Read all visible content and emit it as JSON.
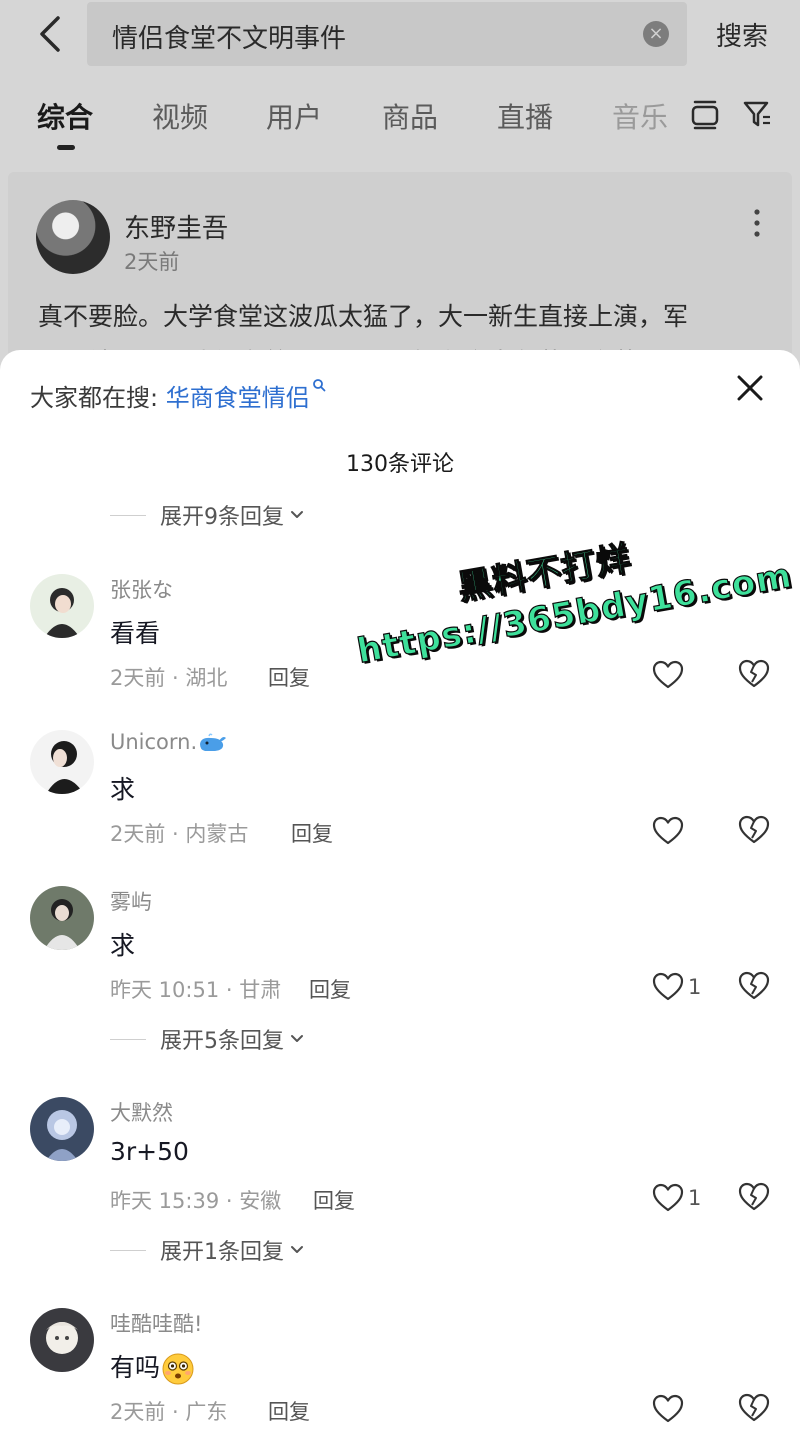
{
  "search": {
    "query": "情侣食堂不文明事件",
    "clear_icon": "×",
    "submit_label": "搜索"
  },
  "tabs": [
    "综合",
    "视频",
    "用户",
    "商品",
    "直播",
    "音乐"
  ],
  "post": {
    "author": "东野圭吾",
    "time": "2天前",
    "text_line1": "真不要脸。大学食堂这波瓜太猛了，大一新生直接上演，军",
    "text_line2": "训刚结束，小情侣穿着迷彩军训服接在食堂角落，竟若无人"
  },
  "sheet": {
    "hot_label": "大家都在搜:",
    "hot_term": "华商食堂情侣",
    "comment_count": "130条评论",
    "expand_top": "展开9条回复"
  },
  "comments": [
    {
      "user": "张张な",
      "text": "看看",
      "meta": "2天前 · 湖北",
      "reply": "回复",
      "likes": ""
    },
    {
      "user": "Unicorn.",
      "text": "求",
      "meta": "2天前 · 内蒙古",
      "reply": "回复",
      "likes": ""
    },
    {
      "user": "雾屿",
      "text": "求",
      "meta": "昨天 10:51 · 甘肃",
      "reply": "回复",
      "likes": "1",
      "expand": "展开5条回复"
    },
    {
      "user": "大默然",
      "text": "3r+50",
      "meta": "昨天 15:39 · 安徽",
      "reply": "回复",
      "likes": "1",
      "expand": "展开1条回复"
    },
    {
      "user": "哇酷哇酷!",
      "text": "有吗",
      "meta": "2天前 · 广东",
      "reply": "回复",
      "likes": ""
    }
  ],
  "watermark": {
    "line1": "黑料不打烊",
    "line2": "https://365bdy16.com"
  },
  "colors": {
    "accent_link": "#2e6fd0",
    "watermark": "#3ee09b"
  }
}
